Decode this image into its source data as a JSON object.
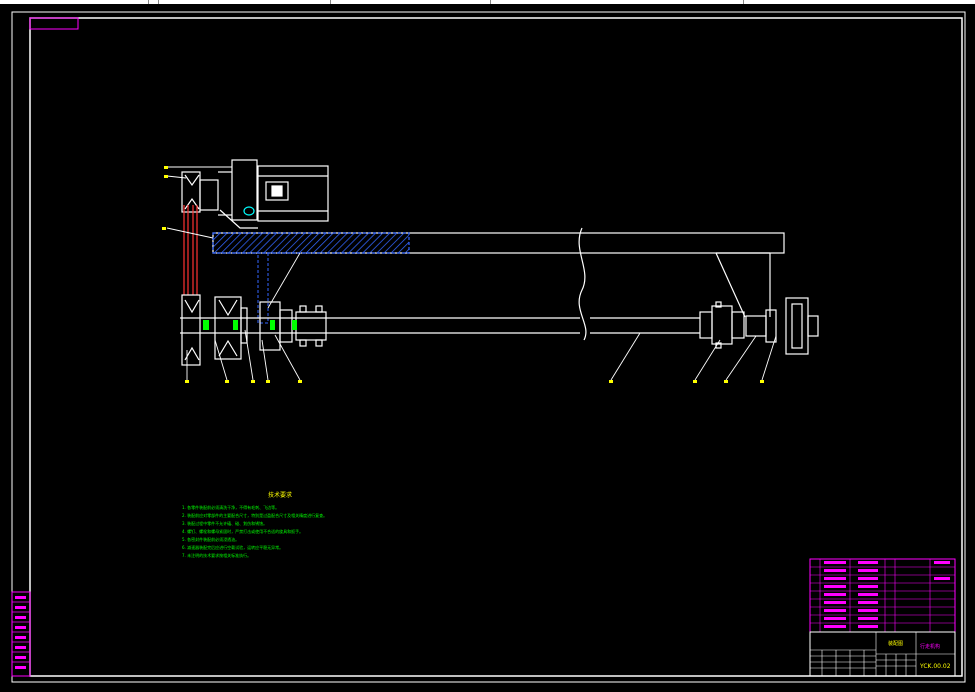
{
  "notes": {
    "title": "技术要求",
    "lines": [
      "1. 各零件装配前必须清洗干净，不得有毛刺、飞边等。",
      "2. 装配前应对零部件的主要配合尺寸，特别是过盈配合尺寸及相关精度进行复查。",
      "3. 装配过程中零件不允许磕、碰、划伤和锈蚀。",
      "4. 螺钉、螺栓和螺母紧固时，严禁打击或使用不合适的旋具和扳手。",
      "5. 各密封件装配前必须浸透油。",
      "6. 减速器装配完后应进行空载试验，运转应平稳无异常。",
      "7. 未注明的技术要求按相关标准执行。"
    ]
  },
  "title_block": {
    "drawing_number": "YCK.00.02",
    "part_name": "行走机构",
    "material_label": "装配图"
  },
  "colors": {
    "frame": "#ffffff",
    "dimension": "#ffff00",
    "hatch": "#3366ff",
    "chain": "#ff3333",
    "green": "#00ff00",
    "cyan": "#00ffff",
    "magenta": "#ff00ff"
  },
  "icons": {
    "motor": "motor-icon",
    "pulley": "pulley-icon",
    "coupling": "coupling-icon",
    "wheel": "wheel-icon"
  }
}
